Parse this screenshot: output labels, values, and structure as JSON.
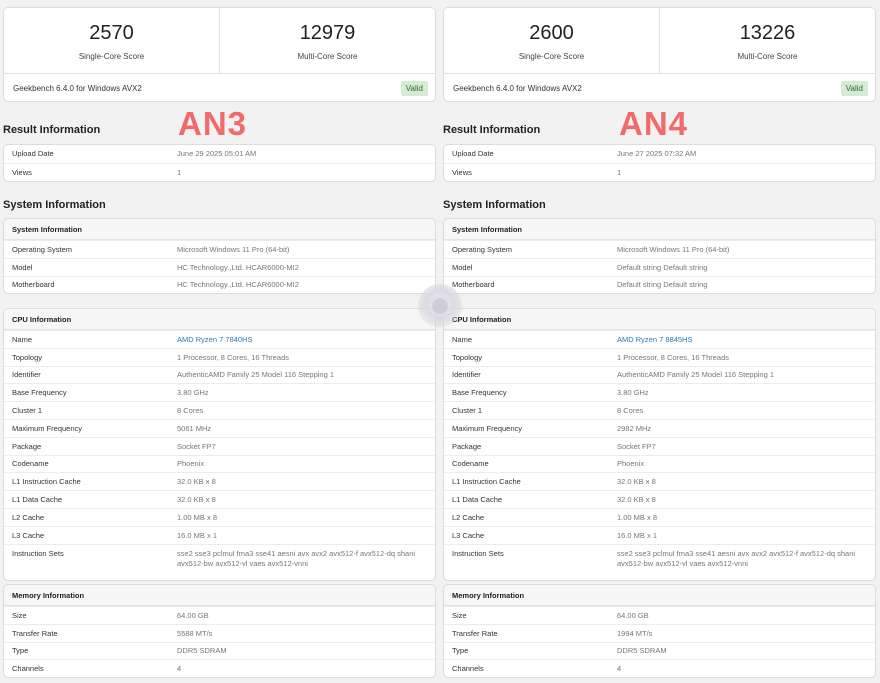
{
  "left": {
    "tag": "AN3",
    "scores": {
      "single": "2570",
      "single_label": "Single-Core Score",
      "multi": "12979",
      "multi_label": "Multi-Core Score"
    },
    "footer": {
      "version": "Geekbench 6.4.0 for Windows AVX2",
      "badge": "Valid"
    },
    "result_title": "Result Information",
    "result": [
      {
        "k": "Upload Date",
        "v": "June 29 2025 05:01 AM"
      },
      {
        "k": "Views",
        "v": "1"
      }
    ],
    "system_title": "System Information",
    "system_head": "System Information",
    "system": [
      {
        "k": "Operating System",
        "v": "Microsoft Windows 11 Pro (64-bit)"
      },
      {
        "k": "Model",
        "v": "HC Technology.,Ltd. HCAR6000-MI2"
      },
      {
        "k": "Motherboard",
        "v": "HC Technology.,Ltd. HCAR6000-MI2"
      }
    ],
    "cpu_head": "CPU Information",
    "cpu": [
      {
        "k": "Name",
        "v": "AMD Ryzen 7 7840HS"
      },
      {
        "k": "Topology",
        "v": "1 Processor, 8 Cores, 16 Threads"
      },
      {
        "k": "Identifier",
        "v": "AuthenticAMD Family 25 Model 116 Stepping 1"
      },
      {
        "k": "Base Frequency",
        "v": "3.80 GHz"
      },
      {
        "k": "Cluster 1",
        "v": "8 Cores"
      },
      {
        "k": "Maximum Frequency",
        "v": "5061 MHz"
      },
      {
        "k": "Package",
        "v": "Socket FP7"
      },
      {
        "k": "Codename",
        "v": "Phoenix"
      },
      {
        "k": "L1 Instruction Cache",
        "v": "32.0 KB x 8"
      },
      {
        "k": "L1 Data Cache",
        "v": "32.0 KB x 8"
      },
      {
        "k": "L2 Cache",
        "v": "1.00 MB x 8"
      },
      {
        "k": "L3 Cache",
        "v": "16.0 MB x 1"
      },
      {
        "k": "Instruction Sets",
        "v": "sse2 sse3 pclmul fma3 sse41 aesni avx avx2 avx512-f avx512-dq shani avx512-bw avx512-vl vaes avx512-vnni"
      }
    ],
    "mem_head": "Memory Information",
    "mem": [
      {
        "k": "Size",
        "v": "64.00 GB"
      },
      {
        "k": "Transfer Rate",
        "v": "5588 MT/s"
      },
      {
        "k": "Type",
        "v": "DDR5 SDRAM"
      },
      {
        "k": "Channels",
        "v": "4"
      }
    ]
  },
  "right": {
    "tag": "AN4",
    "scores": {
      "single": "2600",
      "single_label": "Single-Core Score",
      "multi": "13226",
      "multi_label": "Multi-Core Score"
    },
    "footer": {
      "version": "Geekbench 6.4.0 for Windows AVX2",
      "badge": "Valid"
    },
    "result_title": "Result Information",
    "result": [
      {
        "k": "Upload Date",
        "v": "June 27 2025 07:32 AM"
      },
      {
        "k": "Views",
        "v": "1"
      }
    ],
    "system_title": "System Information",
    "system_head": "System Information",
    "system": [
      {
        "k": "Operating System",
        "v": "Microsoft Windows 11 Pro (64-bit)"
      },
      {
        "k": "Model",
        "v": "Default string Default string"
      },
      {
        "k": "Motherboard",
        "v": "Default string Default string"
      }
    ],
    "cpu_head": "CPU Information",
    "cpu": [
      {
        "k": "Name",
        "v": "AMD Ryzen 7 8845HS"
      },
      {
        "k": "Topology",
        "v": "1 Processor, 8 Cores, 16 Threads"
      },
      {
        "k": "Identifier",
        "v": "AuthenticAMD Family 25 Model 116 Stepping 1"
      },
      {
        "k": "Base Frequency",
        "v": "3.80 GHz"
      },
      {
        "k": "Cluster 1",
        "v": "8 Cores"
      },
      {
        "k": "Maximum Frequency",
        "v": "2982 MHz"
      },
      {
        "k": "Package",
        "v": "Socket FP7"
      },
      {
        "k": "Codename",
        "v": "Phoenix"
      },
      {
        "k": "L1 Instruction Cache",
        "v": "32.0 KB x 8"
      },
      {
        "k": "L1 Data Cache",
        "v": "32.0 KB x 8"
      },
      {
        "k": "L2 Cache",
        "v": "1.00 MB x 8"
      },
      {
        "k": "L3 Cache",
        "v": "16.0 MB x 1"
      },
      {
        "k": "Instruction Sets",
        "v": "sse2 sse3 pclmul fma3 sse41 aesni avx avx2 avx512-f avx512-dq shani avx512-bw avx512-vl vaes avx512-vnni"
      }
    ],
    "mem_head": "Memory Information",
    "mem": [
      {
        "k": "Size",
        "v": "64.00 GB"
      },
      {
        "k": "Transfer Rate",
        "v": "1994 MT/s"
      },
      {
        "k": "Type",
        "v": "DDR5 SDRAM"
      },
      {
        "k": "Channels",
        "v": "4"
      }
    ]
  }
}
